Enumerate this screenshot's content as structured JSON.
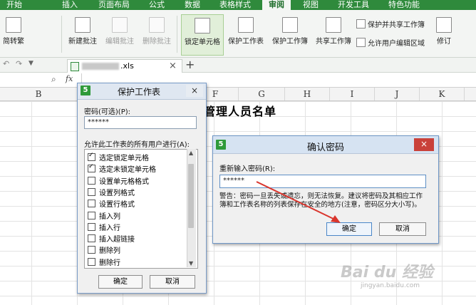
{
  "menu": {
    "items": [
      "开始",
      "插入",
      "页面布局",
      "公式",
      "数据",
      "表格样式",
      "审阅",
      "视图",
      "开发工具",
      "特色功能"
    ],
    "active_index": 6
  },
  "ribbon": {
    "simp_trad": "简转繁",
    "new_comment": "新建批注",
    "edit_comment": "编辑批注",
    "delete_comment": "删除批注",
    "lock_cell": "锁定单元格",
    "protect_sheet": "保护工作表",
    "protect_workbook": "保护工作簿",
    "share_workbook": "共享工作簿",
    "protect_share_workbook": "保护并共享工作簿",
    "allow_edit_ranges": "允许用户编辑区域",
    "revise": "修订"
  },
  "tabs": {
    "doc_name": ".xls",
    "close": "×",
    "add": "+"
  },
  "formula_bar": {
    "fx": "fx"
  },
  "columns": [
    "B",
    "F",
    "G",
    "H",
    "I",
    "J",
    "K"
  ],
  "sheet": {
    "title": "管理人员名单"
  },
  "protect_dialog": {
    "title": "保护工作表",
    "password_label": "密码(可选)(P):",
    "password_value": "******",
    "allow_label": "允许此工作表的所有用户进行(A):",
    "permissions": [
      {
        "label": "选定锁定单元格",
        "checked": true
      },
      {
        "label": "选定未锁定单元格",
        "checked": true
      },
      {
        "label": "设置单元格格式",
        "checked": false
      },
      {
        "label": "设置列格式",
        "checked": false
      },
      {
        "label": "设置行格式",
        "checked": false
      },
      {
        "label": "插入列",
        "checked": false
      },
      {
        "label": "插入行",
        "checked": false
      },
      {
        "label": "插入超链接",
        "checked": false
      },
      {
        "label": "删除列",
        "checked": false
      },
      {
        "label": "删除行",
        "checked": false
      }
    ],
    "ok": "确定",
    "cancel": "取消",
    "close": "×"
  },
  "confirm_dialog": {
    "title": "确认密码",
    "reenter_label": "重新输入密码(R):",
    "password_value": "******",
    "warning": "警告：密码一旦丢失或遗忘，则无法恢复。建议将密码及其相应工作簿和工作表名称的列表保存在安全的地方(注意，密码区分大小写)。",
    "ok": "确定",
    "cancel": "取消",
    "close": "×"
  },
  "watermark": {
    "brand": "Bai du 经验",
    "url": "jingyan.baidu.com"
  },
  "colors": {
    "menu_green": "#2f8a3c",
    "close_red": "#c9413a",
    "arrow_red": "#d9352d"
  }
}
